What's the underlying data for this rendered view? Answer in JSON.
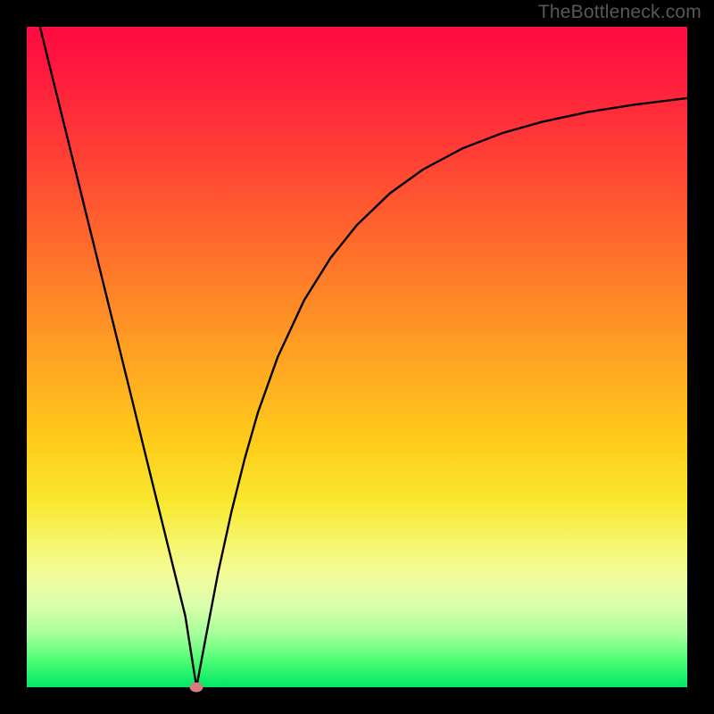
{
  "watermark": "TheBottleneck.com",
  "chart_data": {
    "type": "line",
    "title": "",
    "xlabel": "",
    "ylabel": "",
    "xlim": [
      0,
      100
    ],
    "ylim": [
      0,
      100
    ],
    "series": [
      {
        "name": "bottleneck-curve",
        "x": [
          2,
          4,
          6,
          8,
          10,
          12,
          14,
          16,
          18,
          20,
          22,
          24,
          25.7,
          27,
          29,
          31,
          33,
          35,
          38,
          42,
          46,
          50,
          55,
          60,
          66,
          72,
          78,
          85,
          92,
          100
        ],
        "values": [
          100,
          91.9,
          83.8,
          75.7,
          67.6,
          59.5,
          51.4,
          43.3,
          35.1,
          27,
          18.9,
          10.8,
          0,
          7,
          17.5,
          26.6,
          34.6,
          41.6,
          50,
          58.6,
          65,
          70,
          74.8,
          78.4,
          81.6,
          83.9,
          85.6,
          87.1,
          88.2,
          89.2
        ]
      }
    ],
    "marker": {
      "x": 25.7,
      "y": 0,
      "label": "optimum-point"
    },
    "background_gradient": {
      "top": "#ff0a42",
      "bottom": "#00e865"
    }
  }
}
